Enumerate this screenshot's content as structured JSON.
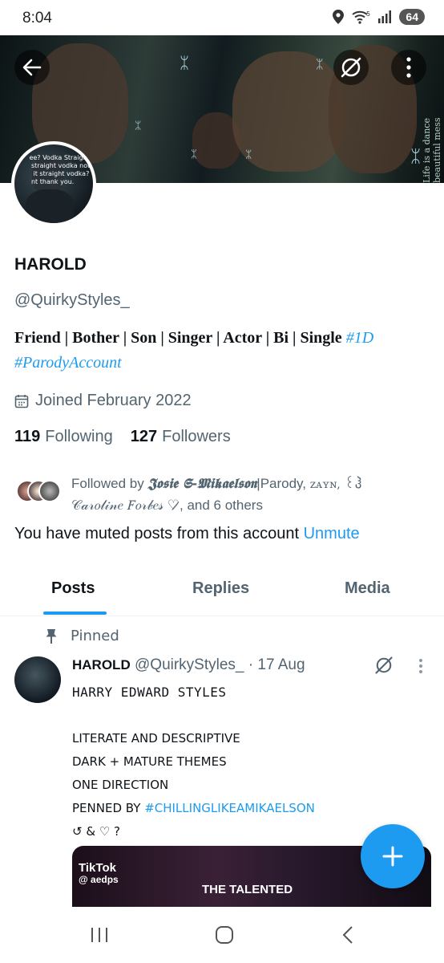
{
  "status_bar": {
    "time": "8:04",
    "battery": "64",
    "icons": [
      "location-icon",
      "wifi-icon",
      "signal-icon",
      "battery-icon"
    ]
  },
  "banner": {
    "avatar_caption": "ee? Vodka Straight?\n straight vodka not\n  it straight vodka?\n nt thank you.",
    "watermark": "Life is a dance beautiful mess",
    "buttons": [
      "back-arrow-icon",
      "muted-icon",
      "more-vertical-icon"
    ]
  },
  "profile": {
    "name": "HAROLD",
    "handle": "@QuirkyStyles_",
    "bio_plain": "Friend | Bother | Son | Singer | Actor | Bi | Single",
    "bio_tag1": "#1D",
    "bio_tag2": "#ParodyAccount",
    "joined": "Joined February 2022",
    "following_count": "119",
    "following_label": "Following",
    "followers_count": "127",
    "followers_label": "Followers"
  },
  "followed_by": {
    "prefix": "Followed by",
    "name1": "𝕵𝖔𝖘𝖎𝖊 𝕾-𝕸𝖎𝖐𝖆𝖊𝖑𝖘𝖔𝖓",
    "name1_suffix": "|Parody,",
    "name2": "ᴢᴀʏɴ,",
    "name2_suffix": "꒰ჰ",
    "name3": "𝒞𝒶𝓇𝑜𝓁𝒾𝓃𝑒 𝐹𝑜𝓇𝒷𝑒𝓈 ♡̷,",
    "others": "and 6 others"
  },
  "muted_notice": {
    "text": "You have muted posts from this account",
    "unmute": "Unmute"
  },
  "tabs": [
    {
      "label": "Posts",
      "active": true
    },
    {
      "label": "Replies",
      "active": false
    },
    {
      "label": "Media",
      "active": false
    }
  ],
  "pinned_post": {
    "pinned_label": "Pinned",
    "author": "HAROLD",
    "handle": "@QuirkyStyles_",
    "date": "· 17 Aug",
    "title": "HARRY EDWARD STYLES",
    "line1": "LITERATE AND DESCRIPTIVE",
    "line2": "DARK + MATURE THEMES",
    "line3": "ONE DIRECTION",
    "line4_prefix": "PENNED BY",
    "line4_tag": "#CHILLINGLIKEAMIKAELSON",
    "line5": "↺ & ♡ ?",
    "media_brand": "TikTok",
    "media_user": "@ aedps",
    "media_caption": "THE TALENTED"
  },
  "fab": {
    "icon": "plus-icon"
  },
  "nav_bar": {
    "buttons": [
      "recents-icon",
      "home-icon",
      "back-icon"
    ]
  },
  "colors": {
    "accent": "#1d9bf0",
    "text": "#0f1419",
    "secondary": "#536471"
  }
}
